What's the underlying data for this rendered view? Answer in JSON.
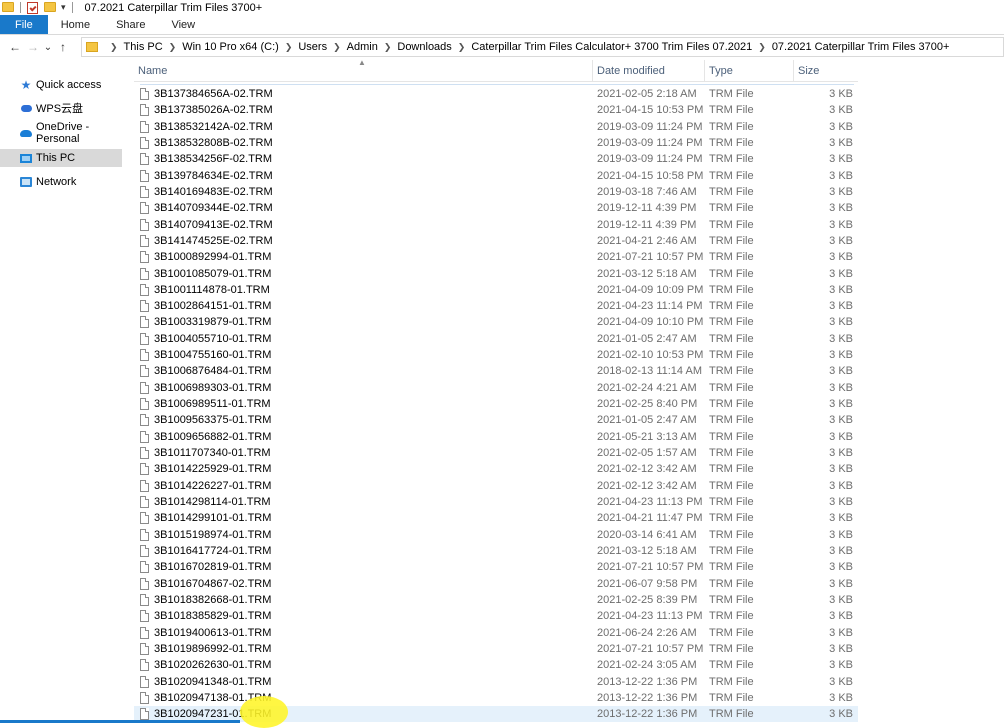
{
  "window": {
    "title": "07.2021 Caterpillar Trim Files 3700+"
  },
  "ribbon": {
    "tabs": [
      "File",
      "Home",
      "Share",
      "View"
    ]
  },
  "address": {
    "back_glyph": "←",
    "forward_glyph": "→",
    "recent_glyph": "⌄",
    "up_glyph": "↑",
    "breadcrumb": [
      "This PC",
      "Win 10 Pro x64 (C:)",
      "Users",
      "Admin",
      "Downloads",
      "Caterpillar Trim Files Calculator+ 3700 Trim Files 07.2021",
      "07.2021 Caterpillar Trim Files 3700+"
    ]
  },
  "nav": {
    "items": [
      {
        "label": "Quick access",
        "icon": "star-icon"
      },
      {
        "label": "WPS云盘",
        "icon": "wps-cloud-icon"
      },
      {
        "label": "OneDrive - Personal",
        "icon": "onedrive-icon"
      },
      {
        "label": "This PC",
        "icon": "pc-icon",
        "selected": true
      },
      {
        "label": "Network",
        "icon": "network-icon"
      }
    ]
  },
  "columns": {
    "name": "Name",
    "date": "Date modified",
    "type": "Type",
    "size": "Size"
  },
  "files": [
    {
      "name": "3B137384656A-02.TRM",
      "date": "2021-02-05 2:18 AM",
      "type": "TRM File",
      "size": "3 KB"
    },
    {
      "name": "3B137385026A-02.TRM",
      "date": "2021-04-15 10:53 PM",
      "type": "TRM File",
      "size": "3 KB"
    },
    {
      "name": "3B138532142A-02.TRM",
      "date": "2019-03-09 11:24 PM",
      "type": "TRM File",
      "size": "3 KB"
    },
    {
      "name": "3B138532808B-02.TRM",
      "date": "2019-03-09 11:24 PM",
      "type": "TRM File",
      "size": "3 KB"
    },
    {
      "name": "3B138534256F-02.TRM",
      "date": "2019-03-09 11:24 PM",
      "type": "TRM File",
      "size": "3 KB"
    },
    {
      "name": "3B139784634E-02.TRM",
      "date": "2021-04-15 10:58 PM",
      "type": "TRM File",
      "size": "3 KB"
    },
    {
      "name": "3B140169483E-02.TRM",
      "date": "2019-03-18 7:46 AM",
      "type": "TRM File",
      "size": "3 KB"
    },
    {
      "name": "3B140709344E-02.TRM",
      "date": "2019-12-11 4:39 PM",
      "type": "TRM File",
      "size": "3 KB"
    },
    {
      "name": "3B140709413E-02.TRM",
      "date": "2019-12-11 4:39 PM",
      "type": "TRM File",
      "size": "3 KB"
    },
    {
      "name": "3B141474525E-02.TRM",
      "date": "2021-04-21 2:46 AM",
      "type": "TRM File",
      "size": "3 KB"
    },
    {
      "name": "3B1000892994-01.TRM",
      "date": "2021-07-21 10:57 PM",
      "type": "TRM File",
      "size": "3 KB"
    },
    {
      "name": "3B1001085079-01.TRM",
      "date": "2021-03-12 5:18 AM",
      "type": "TRM File",
      "size": "3 KB"
    },
    {
      "name": "3B1001114878-01.TRM",
      "date": "2021-04-09 10:09 PM",
      "type": "TRM File",
      "size": "3 KB"
    },
    {
      "name": "3B1002864151-01.TRM",
      "date": "2021-04-23 11:14 PM",
      "type": "TRM File",
      "size": "3 KB"
    },
    {
      "name": "3B1003319879-01.TRM",
      "date": "2021-04-09 10:10 PM",
      "type": "TRM File",
      "size": "3 KB"
    },
    {
      "name": "3B1004055710-01.TRM",
      "date": "2021-01-05 2:47 AM",
      "type": "TRM File",
      "size": "3 KB"
    },
    {
      "name": "3B1004755160-01.TRM",
      "date": "2021-02-10 10:53 PM",
      "type": "TRM File",
      "size": "3 KB"
    },
    {
      "name": "3B1006876484-01.TRM",
      "date": "2018-02-13 11:14 AM",
      "type": "TRM File",
      "size": "3 KB"
    },
    {
      "name": "3B1006989303-01.TRM",
      "date": "2021-02-24 4:21 AM",
      "type": "TRM File",
      "size": "3 KB"
    },
    {
      "name": "3B1006989511-01.TRM",
      "date": "2021-02-25 8:40 PM",
      "type": "TRM File",
      "size": "3 KB"
    },
    {
      "name": "3B1009563375-01.TRM",
      "date": "2021-01-05 2:47 AM",
      "type": "TRM File",
      "size": "3 KB"
    },
    {
      "name": "3B1009656882-01.TRM",
      "date": "2021-05-21 3:13 AM",
      "type": "TRM File",
      "size": "3 KB"
    },
    {
      "name": "3B1011707340-01.TRM",
      "date": "2021-02-05 1:57 AM",
      "type": "TRM File",
      "size": "3 KB"
    },
    {
      "name": "3B1014225929-01.TRM",
      "date": "2021-02-12 3:42 AM",
      "type": "TRM File",
      "size": "3 KB"
    },
    {
      "name": "3B1014226227-01.TRM",
      "date": "2021-02-12 3:42 AM",
      "type": "TRM File",
      "size": "3 KB"
    },
    {
      "name": "3B1014298114-01.TRM",
      "date": "2021-04-23 11:13 PM",
      "type": "TRM File",
      "size": "3 KB"
    },
    {
      "name": "3B1014299101-01.TRM",
      "date": "2021-04-21 11:47 PM",
      "type": "TRM File",
      "size": "3 KB"
    },
    {
      "name": "3B1015198974-01.TRM",
      "date": "2020-03-14 6:41 AM",
      "type": "TRM File",
      "size": "3 KB"
    },
    {
      "name": "3B1016417724-01.TRM",
      "date": "2021-03-12 5:18 AM",
      "type": "TRM File",
      "size": "3 KB"
    },
    {
      "name": "3B1016702819-01.TRM",
      "date": "2021-07-21 10:57 PM",
      "type": "TRM File",
      "size": "3 KB"
    },
    {
      "name": "3B1016704867-02.TRM",
      "date": "2021-06-07 9:58 PM",
      "type": "TRM File",
      "size": "3 KB"
    },
    {
      "name": "3B1018382668-01.TRM",
      "date": "2021-02-25 8:39 PM",
      "type": "TRM File",
      "size": "3 KB"
    },
    {
      "name": "3B1018385829-01.TRM",
      "date": "2021-04-23 11:13 PM",
      "type": "TRM File",
      "size": "3 KB"
    },
    {
      "name": "3B1019400613-01.TRM",
      "date": "2021-06-24 2:26 AM",
      "type": "TRM File",
      "size": "3 KB"
    },
    {
      "name": "3B1019896992-01.TRM",
      "date": "2021-07-21 10:57 PM",
      "type": "TRM File",
      "size": "3 KB"
    },
    {
      "name": "3B1020262630-01.TRM",
      "date": "2021-02-24 3:05 AM",
      "type": "TRM File",
      "size": "3 KB"
    },
    {
      "name": "3B1020941348-01.TRM",
      "date": "2013-12-22 1:36 PM",
      "type": "TRM File",
      "size": "3 KB"
    },
    {
      "name": "3B1020947138-01.TRM",
      "date": "2013-12-22 1:36 PM",
      "type": "TRM File",
      "size": "3 KB"
    },
    {
      "name": "3B1020947231-01.TRM",
      "date": "2013-12-22 1:36 PM",
      "type": "TRM File",
      "size": "3 KB",
      "selected": true
    }
  ],
  "colors": {
    "accent": "#1979ca",
    "selection": "#e5f1fb",
    "cursor_highlight": "#fff528"
  }
}
